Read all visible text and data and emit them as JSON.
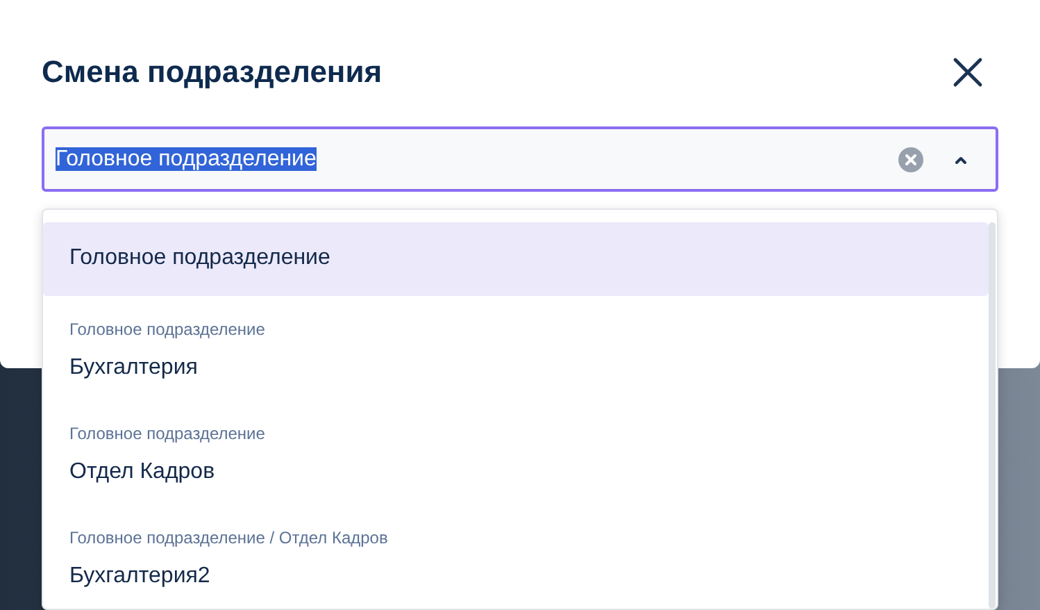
{
  "dialog": {
    "title": "Смена подразделения"
  },
  "select": {
    "value": "Головное подразделение",
    "value_highlighted": true,
    "expanded": true
  },
  "options": [
    {
      "label": "Головное подразделение",
      "selected": true
    },
    {
      "path": "Головное подразделение",
      "label": "Бухгалтерия",
      "selected": false
    },
    {
      "path": "Головное подразделение",
      "label": "Отдел Кадров",
      "selected": false
    },
    {
      "path": "Головное подразделение / Отдел Кадров",
      "label": "Бухгалтерия2",
      "selected": false
    }
  ]
}
